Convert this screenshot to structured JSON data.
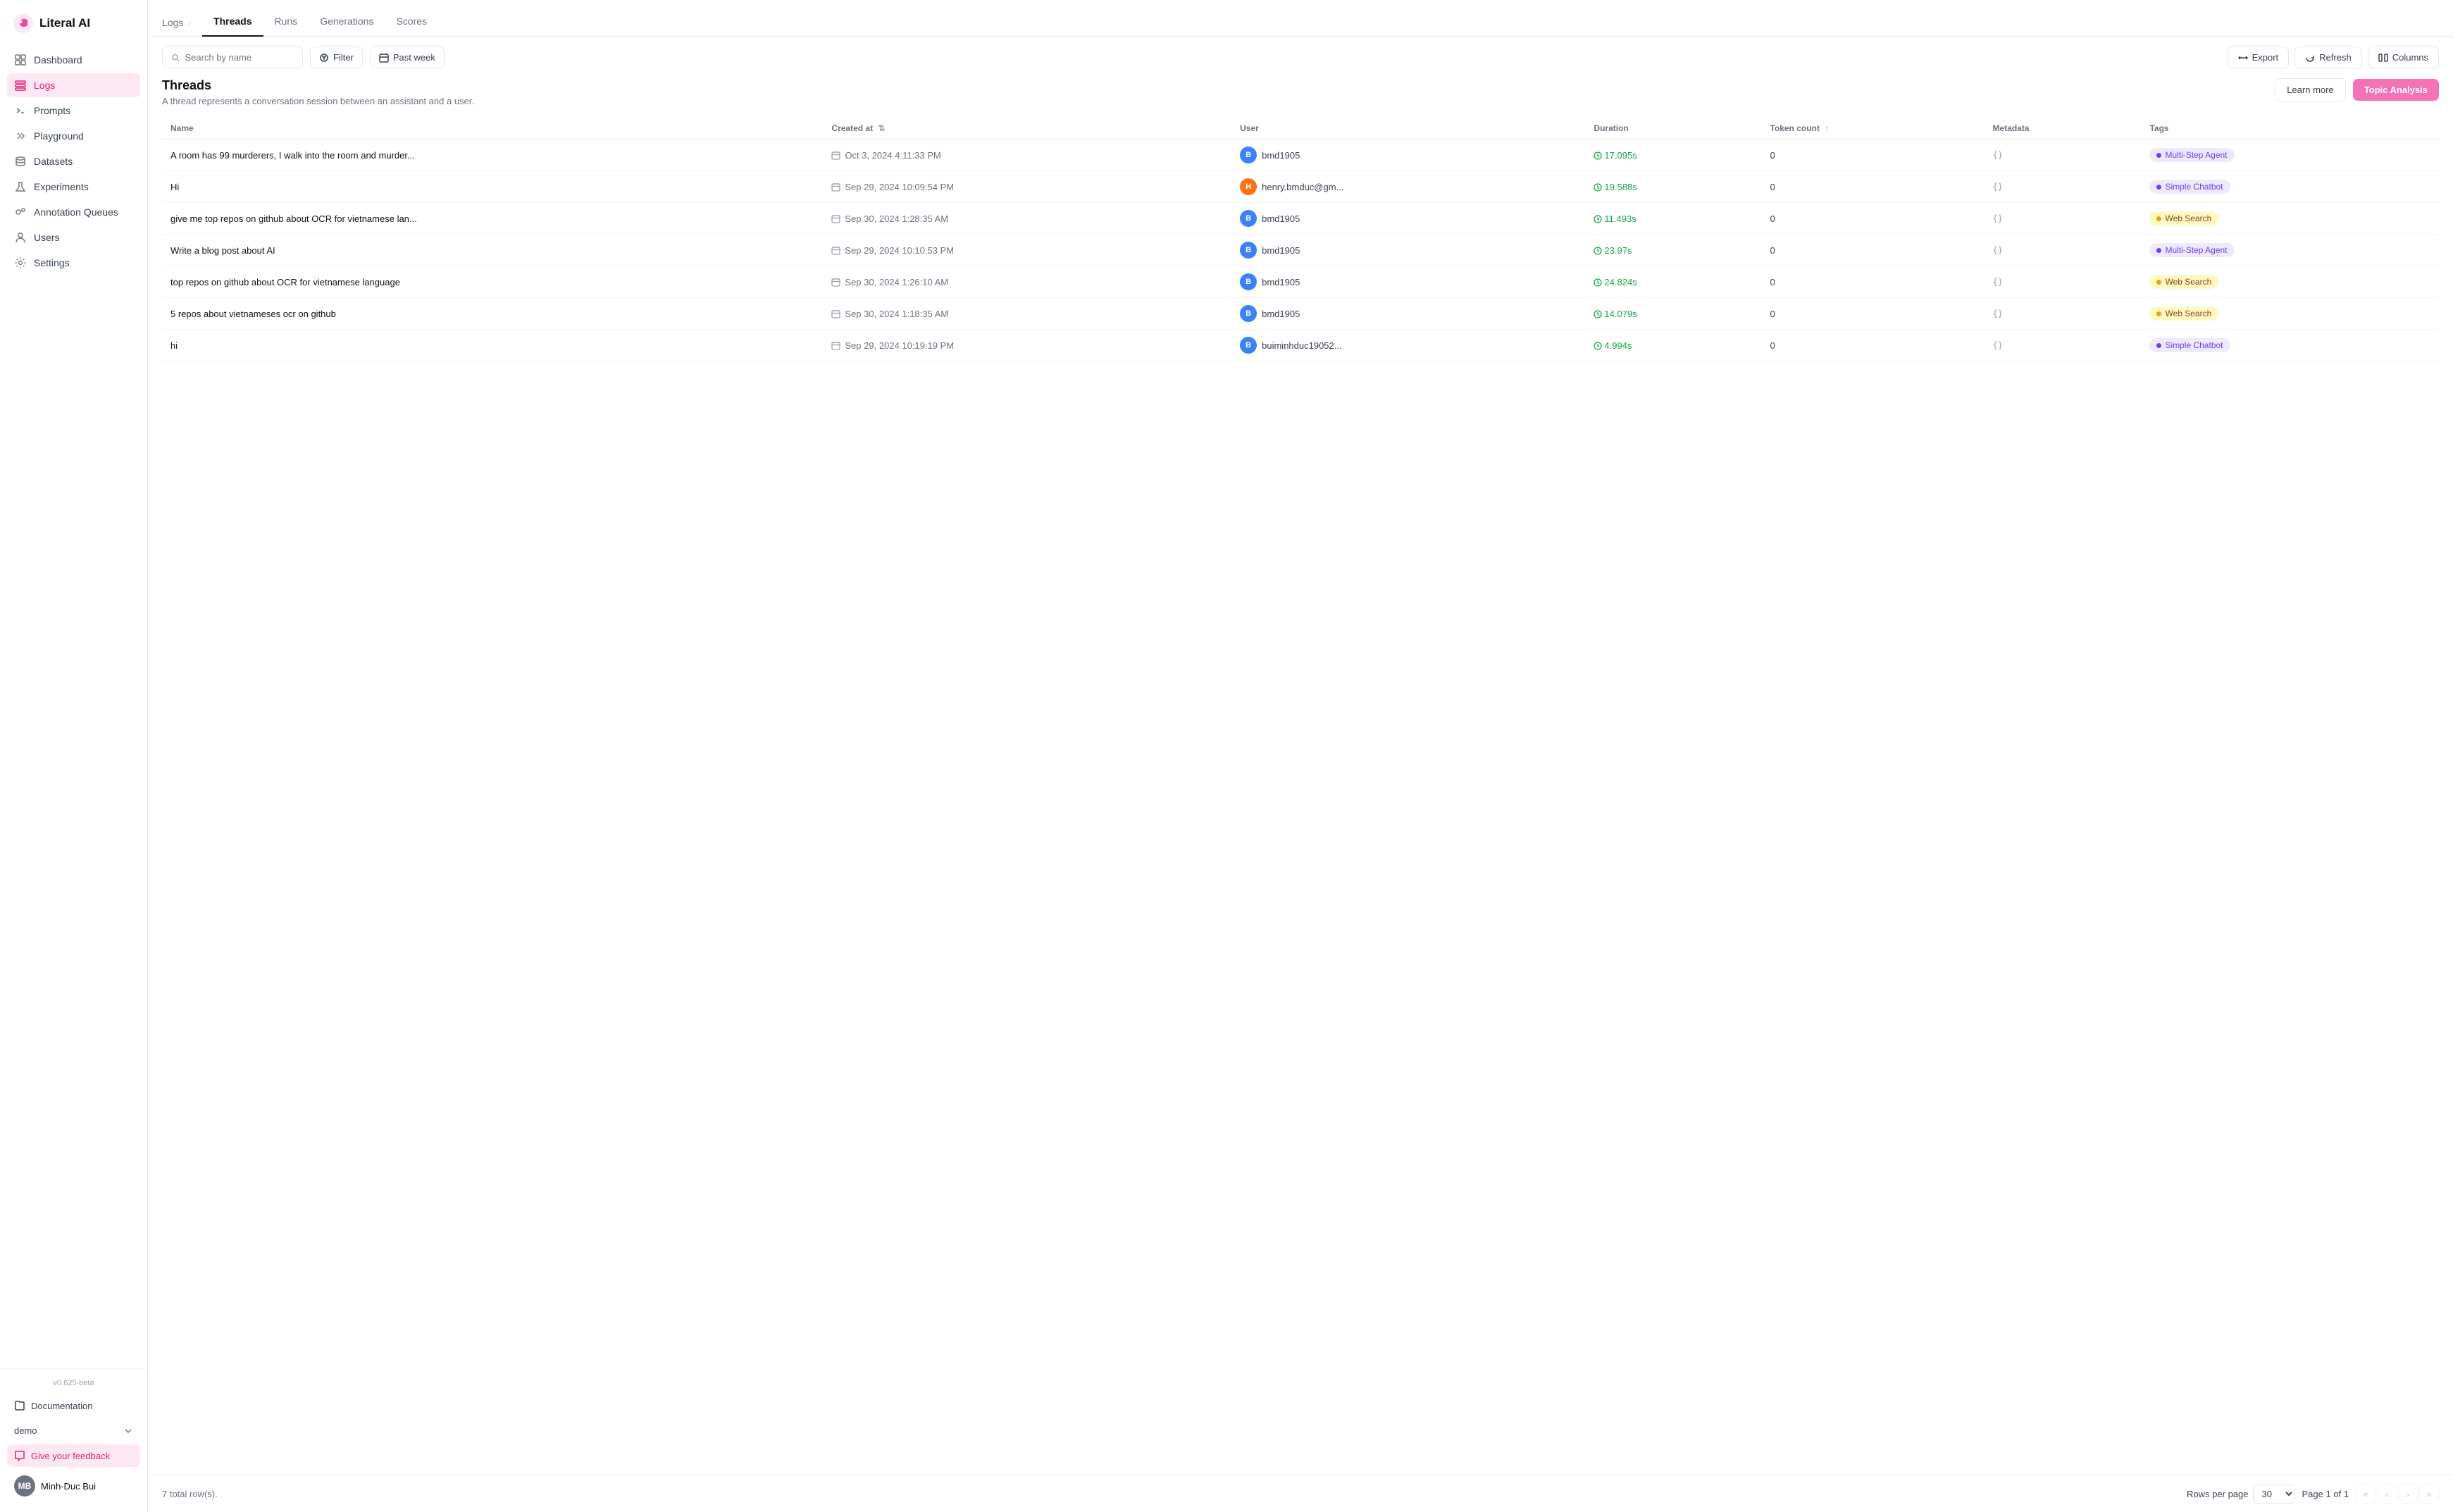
{
  "app": {
    "name": "Literal AI",
    "version": "v0.625-beta"
  },
  "sidebar": {
    "nav_items": [
      {
        "id": "dashboard",
        "label": "Dashboard",
        "icon": "grid"
      },
      {
        "id": "logs",
        "label": "Logs",
        "icon": "list",
        "active": true
      },
      {
        "id": "prompts",
        "label": "Prompts",
        "icon": "terminal"
      },
      {
        "id": "playground",
        "label": "Playground",
        "icon": "chevrons-right"
      },
      {
        "id": "datasets",
        "label": "Datasets",
        "icon": "database"
      },
      {
        "id": "experiments",
        "label": "Experiments",
        "icon": "flask"
      },
      {
        "id": "annotation-queues",
        "label": "Annotation Queues",
        "icon": "users"
      },
      {
        "id": "users",
        "label": "Users",
        "icon": "person"
      },
      {
        "id": "settings",
        "label": "Settings",
        "icon": "gear"
      }
    ],
    "bottom": {
      "documentation_label": "Documentation",
      "demo_label": "demo",
      "feedback_label": "Give your feedback",
      "user_name": "Minh-Duc Bui",
      "user_initials": "MB"
    }
  },
  "breadcrumb": {
    "parent": "Logs",
    "separator": "›"
  },
  "tabs": [
    {
      "id": "threads",
      "label": "Threads",
      "active": true
    },
    {
      "id": "runs",
      "label": "Runs"
    },
    {
      "id": "generations",
      "label": "Generations"
    },
    {
      "id": "scores",
      "label": "Scores"
    }
  ],
  "toolbar": {
    "search_placeholder": "Search by name",
    "filter_label": "Filter",
    "date_label": "Past week",
    "export_label": "Export",
    "refresh_label": "Refresh",
    "columns_label": "Columns"
  },
  "section": {
    "title": "Threads",
    "description": "A thread represents a conversation session between an assistant and a user.",
    "learn_more_label": "Learn more",
    "topic_analysis_label": "Topic Analysis"
  },
  "table": {
    "columns": [
      {
        "id": "name",
        "label": "Name"
      },
      {
        "id": "created_at",
        "label": "Created at",
        "sortable": true
      },
      {
        "id": "user",
        "label": "User"
      },
      {
        "id": "duration",
        "label": "Duration"
      },
      {
        "id": "token_count",
        "label": "Token count",
        "sortable": true
      },
      {
        "id": "metadata",
        "label": "Metadata"
      },
      {
        "id": "tags",
        "label": "Tags"
      }
    ],
    "rows": [
      {
        "name": "A room has 99 murderers, I walk into the room and murder...",
        "created_at": "Oct 3, 2024 4:11:33 PM",
        "user": "bmd1905",
        "user_color": "blue",
        "duration": "17.095s",
        "token_count": "0",
        "metadata": "{}",
        "tag": "Multi-Step Agent",
        "tag_type": "multi"
      },
      {
        "name": "Hi",
        "created_at": "Sep 29, 2024 10:09:54 PM",
        "user": "henry.bmduc@gm...",
        "user_color": "orange",
        "duration": "19.588s",
        "token_count": "0",
        "metadata": "{}",
        "tag": "Simple Chatbot",
        "tag_type": "chatbot"
      },
      {
        "name": "give me top repos on github about OCR for vietnamese lan...",
        "created_at": "Sep 30, 2024 1:28:35 AM",
        "user": "bmd1905",
        "user_color": "blue",
        "duration": "11.493s",
        "token_count": "0",
        "metadata": "{}",
        "tag": "Web Search",
        "tag_type": "websearch"
      },
      {
        "name": "Write a blog post about AI",
        "created_at": "Sep 29, 2024 10:10:53 PM",
        "user": "bmd1905",
        "user_color": "blue",
        "duration": "23.97s",
        "token_count": "0",
        "metadata": "{}",
        "tag": "Multi-Step Agent",
        "tag_type": "multi"
      },
      {
        "name": "top repos on github about OCR for vietnamese language",
        "created_at": "Sep 30, 2024 1:26:10 AM",
        "user": "bmd1905",
        "user_color": "blue",
        "duration": "24.824s",
        "token_count": "0",
        "metadata": "{}",
        "tag": "Web Search",
        "tag_type": "websearch"
      },
      {
        "name": "5 repos about vietnameses ocr on github",
        "created_at": "Sep 30, 2024 1:18:35 AM",
        "user": "bmd1905",
        "user_color": "blue",
        "duration": "14.079s",
        "token_count": "0",
        "metadata": "{}",
        "tag": "Web Search",
        "tag_type": "websearch"
      },
      {
        "name": "hi",
        "created_at": "Sep 29, 2024 10:19:19 PM",
        "user": "buiminhduc19052...",
        "user_color": "blue",
        "duration": "4.994s",
        "token_count": "0",
        "metadata": "{}",
        "tag": "Simple Chatbot",
        "tag_type": "chatbot"
      }
    ]
  },
  "footer": {
    "total_rows": "7 total row(s).",
    "rows_per_page_label": "Rows per page",
    "rows_per_page_value": "30",
    "page_info": "Page 1 of 1"
  }
}
